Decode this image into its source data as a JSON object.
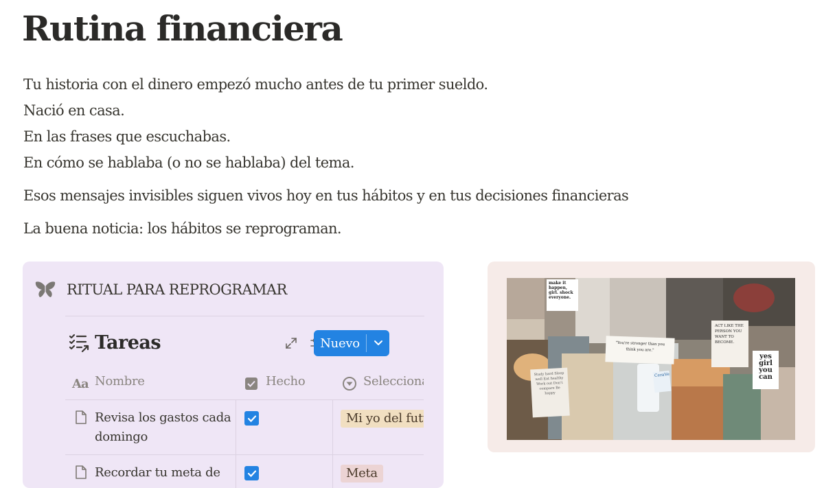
{
  "page": {
    "title": "Rutina financiera",
    "paragraphs": [
      "Tu historia con el dinero empezó mucho antes de tu primer sueldo.",
      "Nació en casa.",
      "En las frases que escuchabas.",
      "En cómo se hablaba (o no se hablaba) del tema.",
      "Esos mensajes invisibles siguen vivos hoy en tus hábitos y en tus decisiones financieras",
      "La buena noticia: los hábitos se reprograman."
    ]
  },
  "callout": {
    "icon": "butterfly-icon",
    "title": "RITUAL PARA REPROGRAMAR",
    "database": {
      "icon": "task-list-icon",
      "title": "Tareas",
      "new_button": "Nuevo",
      "columns": [
        "Nombre",
        "Hecho",
        "Selecciona"
      ],
      "column_icons": [
        "text-property-icon",
        "checkbox-property-icon",
        "select-property-icon"
      ],
      "rows": [
        {
          "name": "Revisa los gastos cada domingo",
          "done": true,
          "tag": "Mi yo del futuro",
          "tag_color": "#f1dfc1"
        },
        {
          "name": "Recordar tu meta de",
          "done": true,
          "tag": "Meta",
          "tag_color": "#ecd4d4"
        }
      ]
    }
  },
  "moodboard": {
    "notes": [
      "make it happen, girl. shock everyone.",
      "\"You're stronger than you think you are.\"",
      "Study hard Sleep well Eat healthy Work out Don't compare Be happy",
      "ACT LIKE THE PERSON YOU WANT TO BECOME.",
      "yes girl you can",
      "CeraVe"
    ]
  },
  "colors": {
    "accent": "#2383e2",
    "callout_bg": "#efe6f6",
    "board_bg": "#f6ebe8",
    "text": "#37352f"
  }
}
